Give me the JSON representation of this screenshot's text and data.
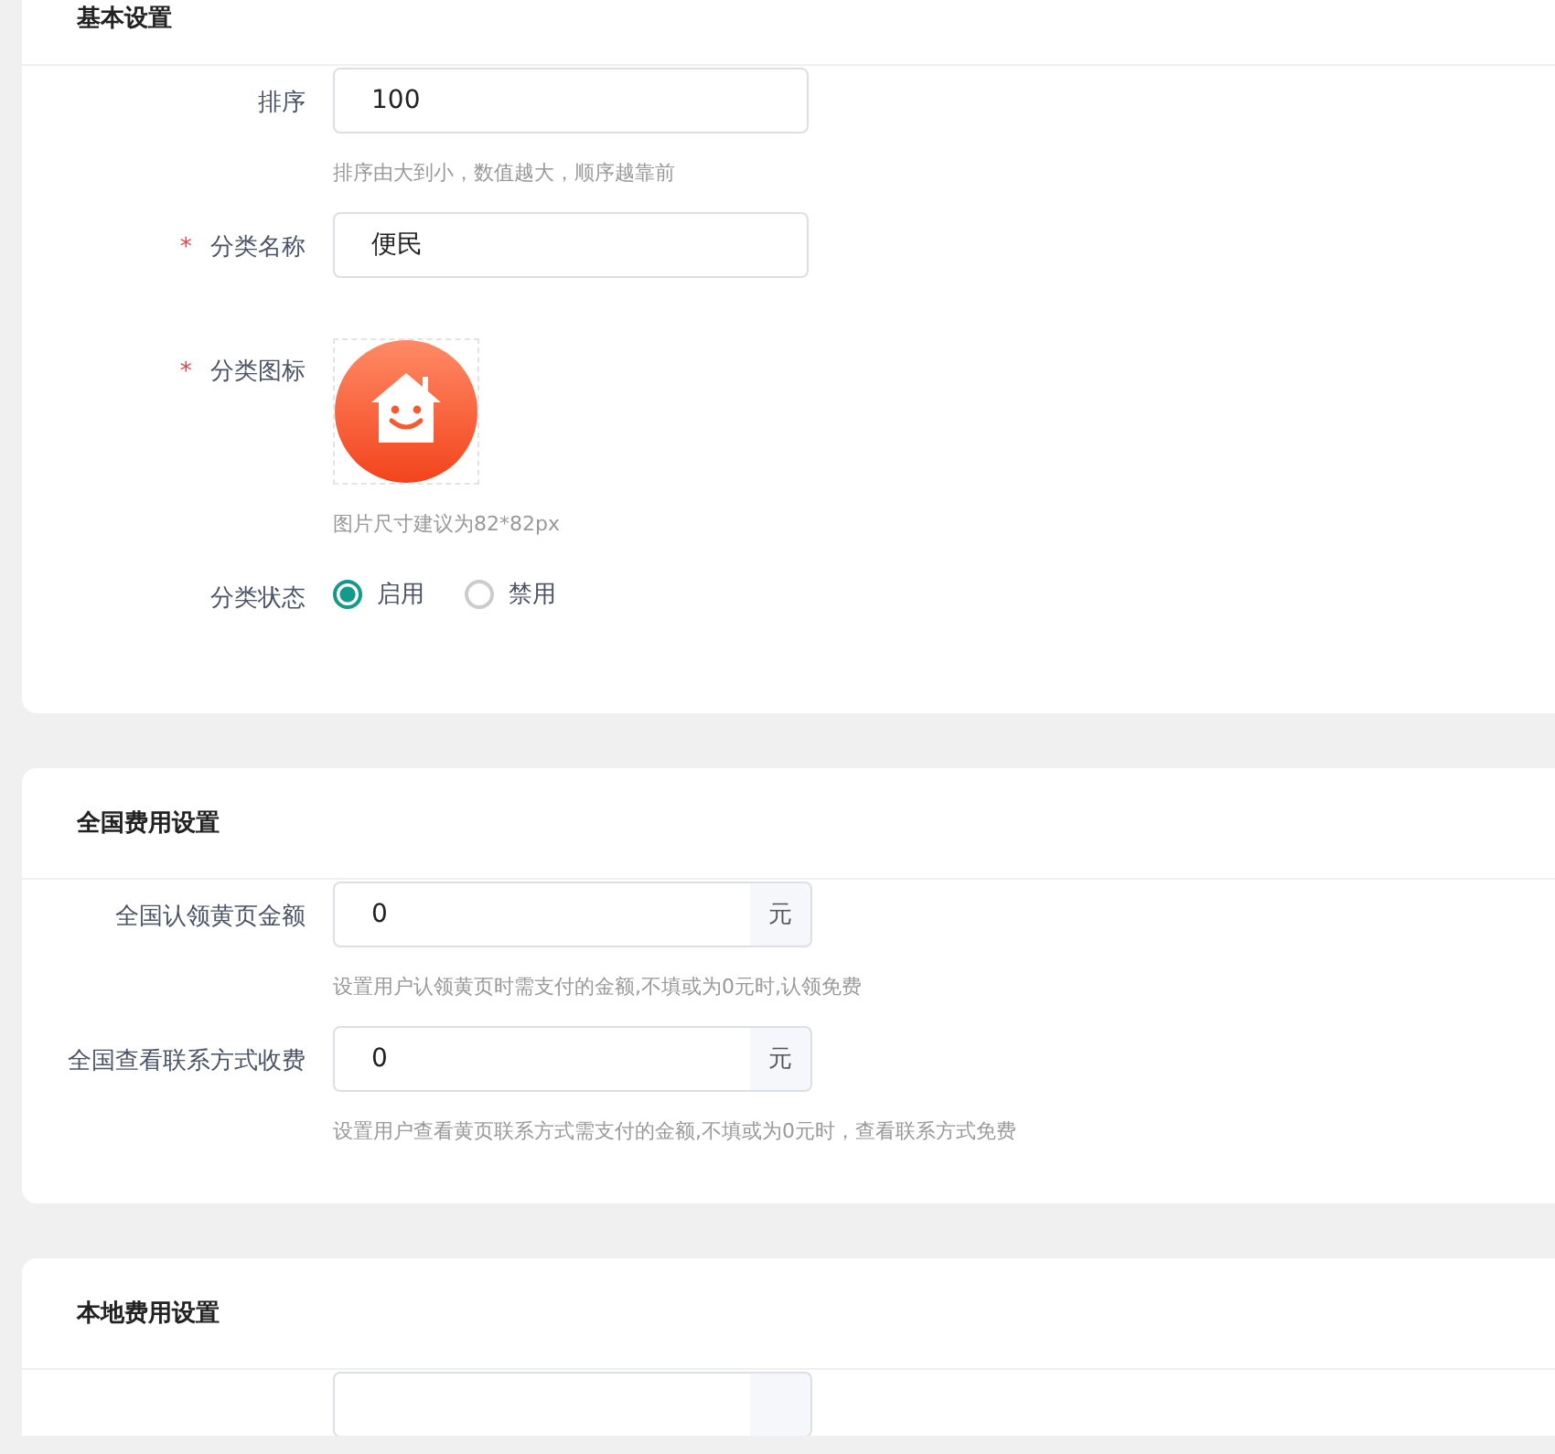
{
  "sections": [
    {
      "title": "基本设置",
      "fields": [
        {
          "kind": "text",
          "label": "排序",
          "value": "100",
          "help": "排序由大到小，数值越大，顺序越靠前"
        },
        {
          "kind": "text",
          "label": "分类名称",
          "required_mark": "*",
          "value": "便民"
        },
        {
          "kind": "image",
          "label": "分类图标",
          "required_mark": "*",
          "help": "图片尺寸建议为82*82px"
        },
        {
          "kind": "radio",
          "label": "分类状态",
          "options": [
            {
              "label": "启用",
              "selected": true
            },
            {
              "label": "禁用",
              "selected": false
            }
          ]
        }
      ]
    },
    {
      "title": "全国费用设置",
      "fields": [
        {
          "kind": "amount",
          "label": "全国认领黄页金额",
          "value": "0",
          "unit": "元",
          "help": "设置用户认领黄页时需支付的金额,不填或为0元时,认领免费"
        },
        {
          "kind": "amount",
          "label": "全国查看联系方式收费",
          "value": "0",
          "unit": "元",
          "help": "设置用户查看黄页联系方式需支付的金额,不填或为0元时，查看联系方式免费"
        }
      ]
    },
    {
      "title": "本地费用设置",
      "fields": [
        {
          "kind": "amount"
        }
      ]
    }
  ]
}
